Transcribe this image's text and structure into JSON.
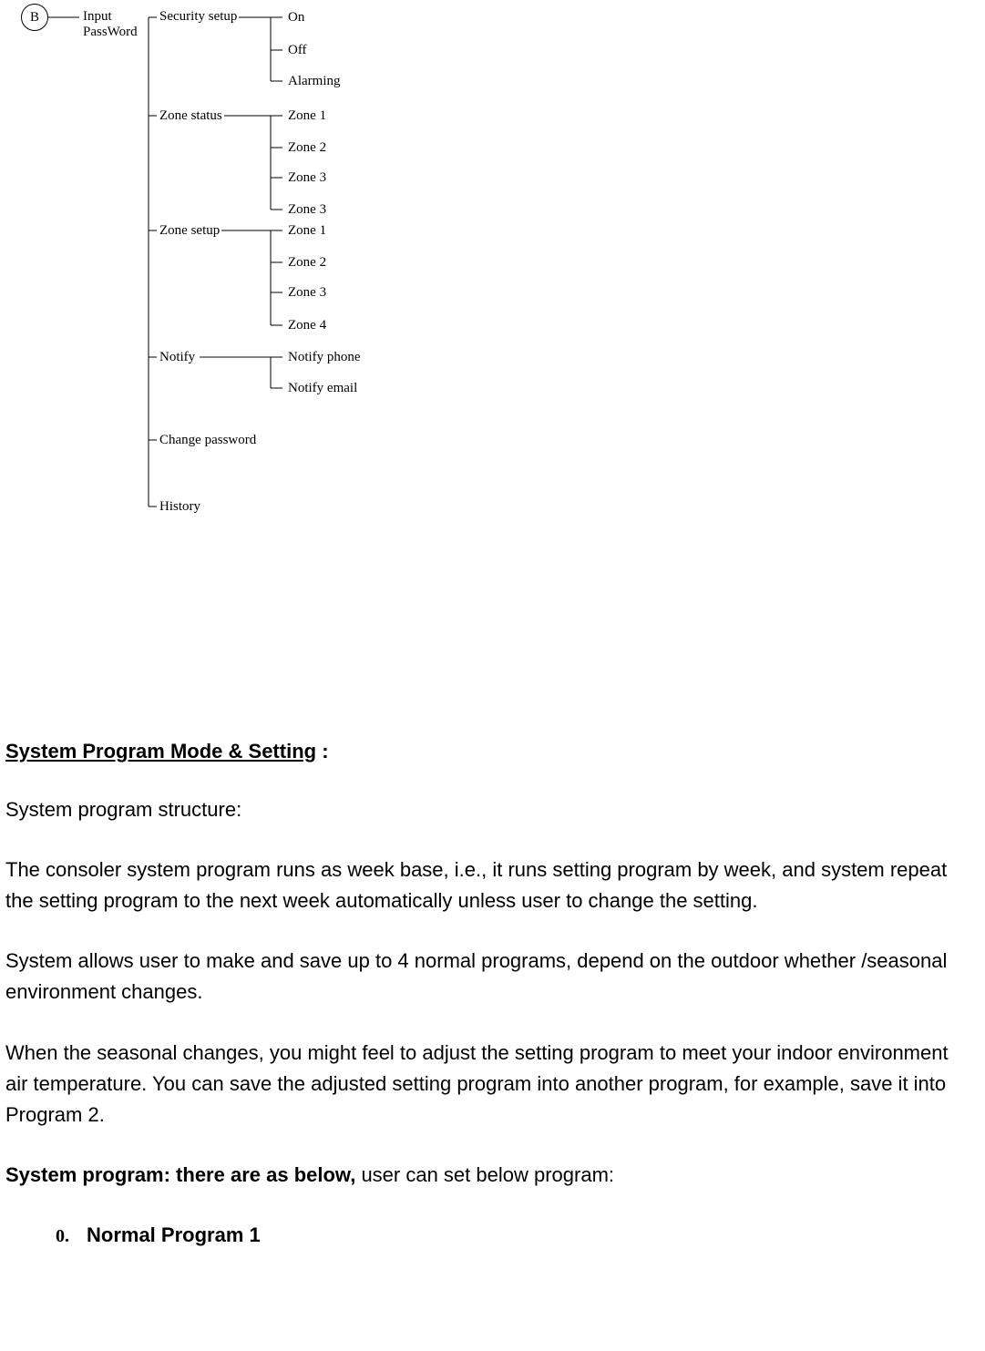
{
  "diagram": {
    "root_badge": "B",
    "root_label_line1": "Input",
    "root_label_line2": "PassWord",
    "branches": {
      "security_setup": {
        "label": "Security setup",
        "children": [
          "On",
          "Off",
          "Alarming"
        ]
      },
      "zone_status": {
        "label": "Zone status",
        "children": [
          "Zone 1",
          "Zone 2",
          "Zone 3",
          "Zone 3"
        ]
      },
      "zone_setup": {
        "label": "Zone setup",
        "children": [
          "Zone 1",
          "Zone 2",
          "Zone 3",
          "Zone 4"
        ]
      },
      "notify": {
        "label": "Notify",
        "children": [
          "Notify phone",
          "Notify email"
        ]
      },
      "change_password": {
        "label": "Change password"
      },
      "history": {
        "label": "History"
      }
    }
  },
  "content": {
    "heading_underlined": "System Program Mode & Setting",
    "heading_suffix": " :",
    "p1": "System program structure:",
    "p2": "The consoler system program runs as week base, i.e., it runs setting program by week, and system repeat the setting program to the next week automatically unless user to change the setting.",
    "p3": "System allows user to make and save up to 4 normal programs, depend on the outdoor whether /seasonal environment changes.",
    "p4": "When the seasonal changes, you might feel to adjust the setting program to meet your indoor environment air temperature.   You can save the adjusted setting program into another program, for example, save it into Program 2.",
    "p5_bold": "System program: there are as below,",
    "p5_rest": " user can set below program:",
    "list": {
      "num": "0.",
      "text": "Normal Program 1"
    }
  }
}
